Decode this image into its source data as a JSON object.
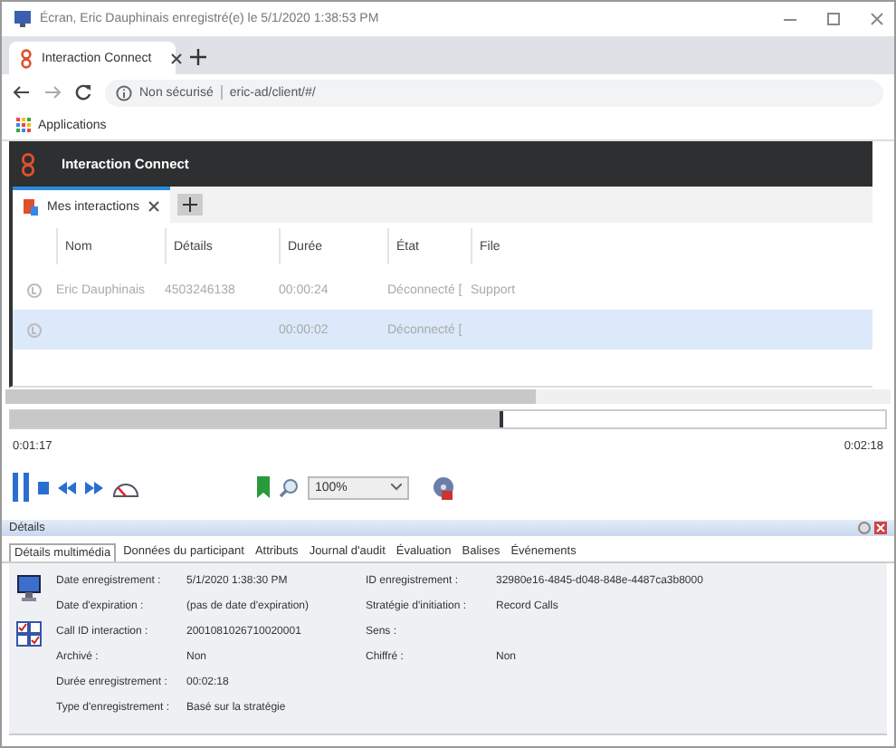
{
  "window": {
    "title": "Écran, Eric Dauphinais enregistré(e) le 5/1/2020 1:38:53 PM"
  },
  "browser": {
    "tab": "Interaction Connect",
    "security": "Non sécurisé",
    "url": "eric-ad/client/#/",
    "bookmark": "Applications"
  },
  "app": {
    "title": "Interaction Connect"
  },
  "view_tabs": [
    {
      "label": "Mes interactions",
      "selected": true
    }
  ],
  "table": {
    "columns": [
      "Nom",
      "Détails",
      "Durée",
      "État",
      "File"
    ],
    "rows": [
      {
        "selected": false,
        "cells": [
          "Eric Dauphinais",
          "4503246138",
          "00:00:24",
          "Déconnecté [",
          "Support"
        ]
      },
      {
        "selected": true,
        "cells": [
          "",
          "",
          "00:00:02",
          "Déconnecté [",
          ""
        ]
      }
    ]
  },
  "player": {
    "level": 0.56,
    "elapsed": "0:01:17",
    "total": "0:02:18",
    "zoom": "100%"
  },
  "details": {
    "title": "Détails",
    "tabs": [
      {
        "label": "Détails multimédia",
        "selected": true
      },
      {
        "label": "Données du participant",
        "selected": false
      },
      {
        "label": "Attributs",
        "selected": false
      },
      {
        "label": "Journal d'audit",
        "selected": false
      },
      {
        "label": "Évaluation",
        "selected": false
      },
      {
        "label": "Balises",
        "selected": false
      },
      {
        "label": "Événements",
        "selected": false
      }
    ],
    "left": [
      {
        "label": "Date enregistrement :",
        "value": "5/1/2020 1:38:30 PM"
      },
      {
        "label": "Date d'expiration :",
        "value": "(pas de date d'expiration)"
      },
      {
        "label": "Call ID interaction :",
        "value": "2001081026710020001"
      },
      {
        "label": "Archivé :",
        "value": "Non"
      },
      {
        "label": "Durée enregistrement :",
        "value": "00:02:18"
      },
      {
        "label": "Type d'enregistrement :",
        "value": "Basé sur la stratégie"
      }
    ],
    "right": [
      {
        "label": "ID enregistrement :",
        "value": "32980e16-4845-d048-848e-4487ca3b8000"
      },
      {
        "label": "Stratégie d'initiation :",
        "value": "Record Calls"
      },
      {
        "label": "Sens :"
      },
      {
        "label": "Chiffré :",
        "value": "Non"
      }
    ]
  }
}
